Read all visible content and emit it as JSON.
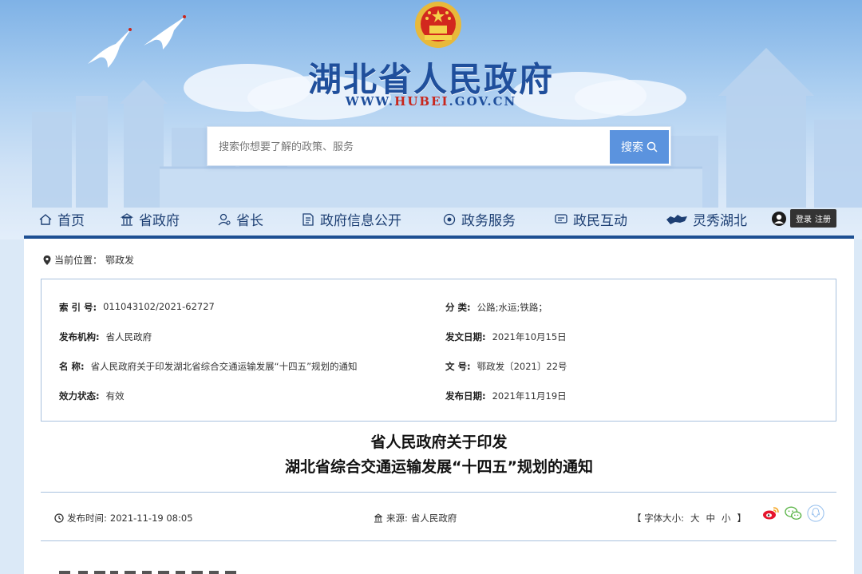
{
  "header": {
    "site_title": "湖北省人民政府",
    "site_url_prefix": "WWW.",
    "site_url_highlight": "HUBEI",
    "site_url_suffix": ".GOV.CN",
    "search_placeholder": "搜索你想要了解的政策、服务",
    "search_button": "搜索"
  },
  "nav": {
    "items": [
      {
        "label": "首页",
        "icon": "home-icon"
      },
      {
        "label": "省政府",
        "icon": "building-icon"
      },
      {
        "label": "省长",
        "icon": "person-icon"
      },
      {
        "label": "政府信息公开",
        "icon": "document-icon"
      },
      {
        "label": "政务服务",
        "icon": "service-icon"
      },
      {
        "label": "政民互动",
        "icon": "chat-icon"
      },
      {
        "label": "灵秀湖北",
        "icon": "hubei-map-icon"
      }
    ],
    "login": "登录",
    "register": "注册"
  },
  "breadcrumb": {
    "label": "当前位置：",
    "current": "鄂政发"
  },
  "meta": {
    "index_key": "索 引 号:",
    "index_val": "011043102/2021-62727",
    "category_key": "分 类:",
    "category_val": "公路;水运;铁路；",
    "issuer_key": "发布机构:",
    "issuer_val": "省人民政府",
    "issue_date_key": "发文日期:",
    "issue_date_val": "2021年10月15日",
    "name_key": "名 称:",
    "name_val": "省人民政府关于印发湖北省综合交通运输发展“十四五”规划的通知",
    "doc_no_key": "文 号:",
    "doc_no_val": "鄂政发〔2021〕22号",
    "status_key": "效力状态:",
    "status_val": "有效",
    "publish_date_key": "发布日期:",
    "publish_date_val": "2021年11月19日"
  },
  "document": {
    "title_line1": "省人民政府关于印发",
    "title_line2": "湖北省综合交通运输发展“十四五”规划的通知",
    "publish_time_label": "发布时间:",
    "publish_time": "2021-11-19 08:05",
    "source_label": "来源:",
    "source": "省人民政府",
    "font_size_label": "【 字体大小:",
    "font_large": "大",
    "font_medium": "中",
    "font_small": "小",
    "font_close": "】"
  },
  "colors": {
    "brand_blue": "#1f4f9c",
    "nav_bar": "#1d4f93",
    "search_button": "#5b93de",
    "url_red": "#c8261c"
  }
}
